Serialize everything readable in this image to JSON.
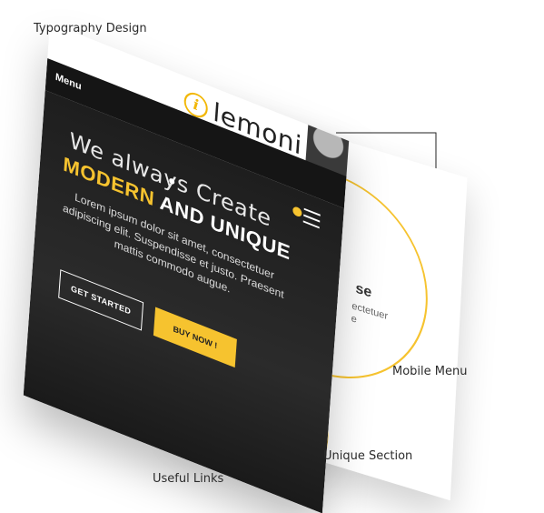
{
  "callouts": {
    "typography": "Typography Design",
    "mobile_menu": "Mobile Menu",
    "unique_section": "Unique Section",
    "useful_links": "Useful Links"
  },
  "front_page": {
    "logo_letter": "i",
    "logo_text": "lemoni",
    "menu_label": "Menu",
    "hero_line1": "We always Create",
    "hero_accent": "MODERN",
    "hero_rest": " AND UNIQUE",
    "hero_desc": "Lorem ipsum dolor sit amet, consectetuer adipiscing elit. Suspendisse et justo. Praesent mattis commodo augue.",
    "btn_started": "GET STARTED",
    "btn_buy": "BUY NOW !"
  },
  "back_page": {
    "heading_fragment": "se",
    "text_fragment1": "ectetuer",
    "text_fragment2": "e"
  },
  "colors": {
    "accent": "#f6c32f",
    "dark": "#151515",
    "text": "#2b2b2b"
  }
}
